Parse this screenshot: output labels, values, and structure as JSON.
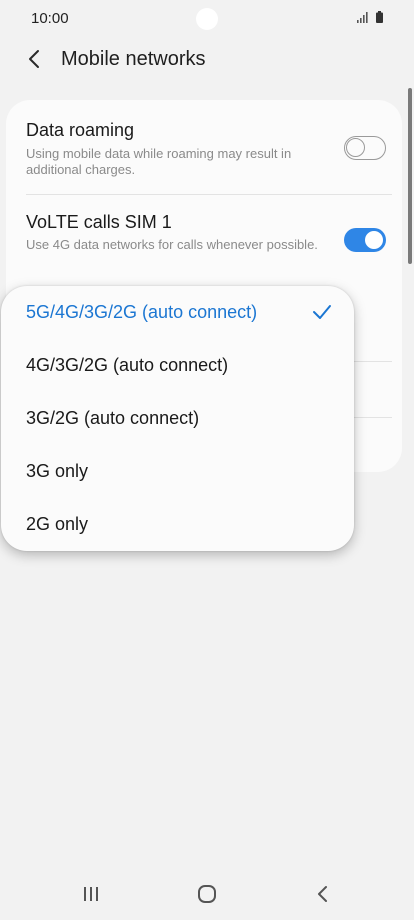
{
  "status_bar": {
    "time": "10:00"
  },
  "header": {
    "title": "Mobile networks"
  },
  "settings": [
    {
      "title": "Data roaming",
      "description": "Using mobile data while roaming may result in additional charges.",
      "toggle_on": false
    },
    {
      "title": "VoLTE calls SIM 1",
      "description": "Use 4G data networks for calls whenever possible.",
      "toggle_on": true
    }
  ],
  "network_mode_menu": {
    "options": [
      {
        "label": "5G/4G/3G/2G (auto connect)",
        "selected": true
      },
      {
        "label": "4G/3G/2G (auto connect)",
        "selected": false
      },
      {
        "label": "3G/2G (auto connect)",
        "selected": false
      },
      {
        "label": "3G only",
        "selected": false
      },
      {
        "label": "2G only",
        "selected": false
      }
    ]
  },
  "colors": {
    "accent": "#1b76d2",
    "toggle_on": "#2f86e6",
    "background": "#f2f2f2"
  }
}
